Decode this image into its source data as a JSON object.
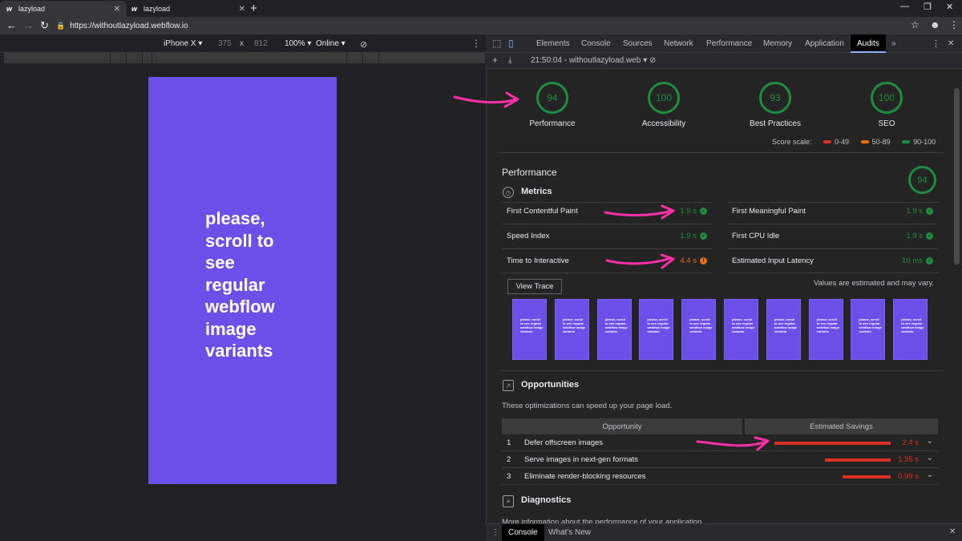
{
  "browser": {
    "tabs": [
      {
        "favicon": "w",
        "title": "lazyload"
      },
      {
        "favicon": "w",
        "title": "lazyload"
      }
    ],
    "new_tab": "+",
    "url": "https://withoutlazyload.webflow.io"
  },
  "device_toolbar": {
    "device": "iPhone X",
    "width": "375",
    "times": "x",
    "height": "812",
    "zoom": "100%",
    "network": "Online"
  },
  "page": {
    "text_lines": [
      "please,",
      "scroll to",
      "see",
      "regular",
      "webflow",
      "image",
      "variants"
    ]
  },
  "devtools": {
    "tabs": [
      "Elements",
      "Console",
      "Sources",
      "Network",
      "Performance",
      "Memory",
      "Application",
      "Audits"
    ],
    "active_tab": "Audits",
    "more": "»",
    "report_selector": "21:50:04 - withoutlazyload.web",
    "gauges": [
      {
        "score": "94",
        "label": "Performance"
      },
      {
        "score": "100",
        "label": "Accessibility"
      },
      {
        "score": "93",
        "label": "Best Practices"
      },
      {
        "score": "100",
        "label": "SEO"
      }
    ],
    "score_scale": {
      "label": "Score scale:",
      "ranges": [
        {
          "text": "0-49",
          "color": "#d93025"
        },
        {
          "text": "50-89",
          "color": "#e8710a"
        },
        {
          "text": "90-100",
          "color": "#1e8e3e"
        }
      ]
    },
    "performance": {
      "title": "Performance",
      "score": "94",
      "metrics_title": "Metrics",
      "metrics": [
        {
          "label": "First Contentful Paint",
          "value": "1.9 s",
          "status": "pass"
        },
        {
          "label": "First Meaningful Paint",
          "value": "1.9 s",
          "status": "pass"
        },
        {
          "label": "Speed Index",
          "value": "1.9 s",
          "status": "pass"
        },
        {
          "label": "First CPU Idle",
          "value": "1.9 s",
          "status": "pass"
        },
        {
          "label": "Time to Interactive",
          "value": "4.4 s",
          "status": "average"
        },
        {
          "label": "Estimated Input Latency",
          "value": "10 ms",
          "status": "pass"
        }
      ],
      "view_trace": "View Trace",
      "estimate_note": "Values are estimated and may vary.",
      "filmstrip_count": 10,
      "filmstrip_text": "please, scroll to see regular webflow image variants"
    },
    "opportunities": {
      "title": "Opportunities",
      "description": "These optimizations can speed up your page load.",
      "col_opportunity": "Opportunity",
      "col_savings": "Estimated Savings",
      "rows": [
        {
          "num": "1",
          "label": "Defer offscreen images",
          "savings": "2.4 s",
          "fraction": 1.0
        },
        {
          "num": "2",
          "label": "Serve images in next-gen formats",
          "savings": "1.35 s",
          "fraction": 0.5625
        },
        {
          "num": "3",
          "label": "Eliminate render-blocking resources",
          "savings": "0.99 s",
          "fraction": 0.4125
        }
      ]
    },
    "diagnostics": {
      "title": "Diagnostics",
      "description": "More information about the performance of your application."
    },
    "drawer": {
      "tabs": [
        "Console",
        "What's New"
      ]
    }
  },
  "annotation_color": "#ff2fa8"
}
